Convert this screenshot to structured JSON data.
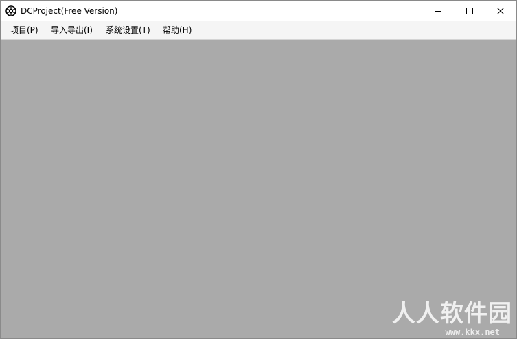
{
  "window": {
    "title": "DCProject(Free Version)"
  },
  "icons": {
    "app": "gear-icon",
    "minimize": "minimize-icon",
    "maximize": "maximize-icon",
    "close": "close-icon"
  },
  "menubar": {
    "items": [
      {
        "label": "项目(P)"
      },
      {
        "label": "导入导出(I)"
      },
      {
        "label": "系统设置(T)"
      },
      {
        "label": "帮助(H)"
      }
    ]
  },
  "watermark": {
    "text": "人人软件园",
    "url": "www.kkx.net"
  },
  "colors": {
    "client_area": "#aaaaaa",
    "menubar": "#f5f5f5",
    "titlebar": "#ffffff"
  }
}
